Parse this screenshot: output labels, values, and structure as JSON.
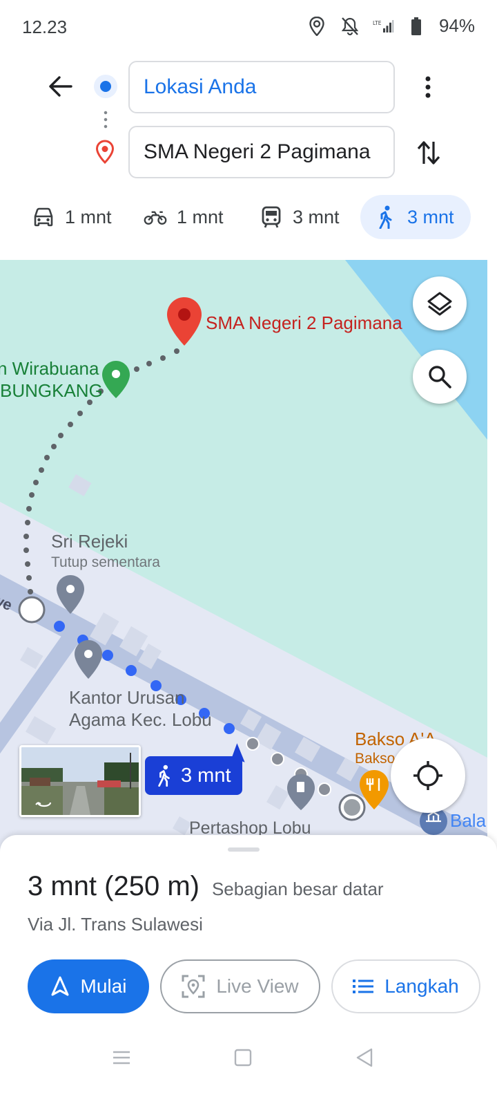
{
  "status": {
    "time": "12.23",
    "battery": "94%",
    "icons": [
      "location-icon",
      "mute-icon",
      "lte-signal-icon",
      "battery-icon"
    ]
  },
  "header": {
    "origin": "Lokasi Anda",
    "destination": "SMA Negeri 2 Pagimana",
    "back_icon": "arrow-back-icon",
    "more_icon": "more-vert-icon",
    "swap_icon": "swap-vert-icon"
  },
  "modes": [
    {
      "icon": "car-icon",
      "label": "1 mnt",
      "active": false
    },
    {
      "icon": "motorcycle-icon",
      "label": "1 mnt",
      "active": false
    },
    {
      "icon": "transit-icon",
      "label": "3 mnt",
      "active": false
    },
    {
      "icon": "walk-icon",
      "label": "3 mnt",
      "active": true
    }
  ],
  "map": {
    "destination_label": "SMA Negeri 2 Pagimana",
    "place1_line1": "n Wirabuana",
    "place1_line2": "BUNGKANG",
    "place2": "Sri Rejeki",
    "place2_status": "Tutup sementara",
    "place3_line1": "Kantor Urusan",
    "place3_line2": "Agama Kec. Lobu",
    "place4_line1": "Bakso A'A",
    "place4_line2": "Bakso",
    "place5": "Pertashop Lobu",
    "place6": "Bala",
    "road_fragment": "we",
    "eta_label": "3 mnt"
  },
  "sheet": {
    "duration": "3 mnt (250 m)",
    "terrain": "Sebagian besar datar",
    "via": "Via Jl. Trans Sulawesi",
    "start_label": "Mulai",
    "live_view_label": "Live View",
    "steps_label": "Langkah"
  },
  "colors": {
    "accent": "#1a73e8",
    "map_land": "#c6ece6",
    "map_water": "#8dd3f2",
    "pin_red": "#ea4335"
  }
}
